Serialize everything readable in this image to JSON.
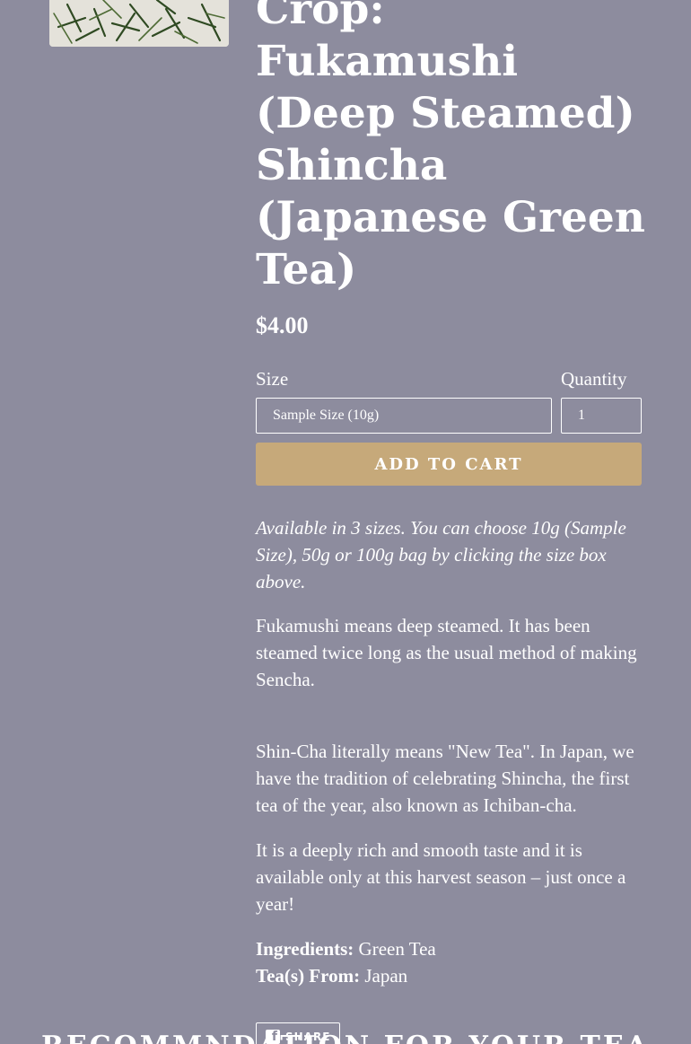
{
  "product": {
    "title": "Crop: Fukamushi (Deep Steamed) Shincha (Japanese Green Tea)",
    "price": "$4.00",
    "size_label": "Size",
    "quantity_label": "Quantity",
    "size_selected": "Sample Size (10g)",
    "quantity_value": "1",
    "add_to_cart": "ADD TO CART"
  },
  "description": {
    "availability": "Available in 3 sizes. You can choose 10g (Sample Size), 50g or 100g bag by clicking the size box above.",
    "fukamushi": "Fukamushi means deep steamed. It has been steamed twice long as the usual method of making Sencha.",
    "shincha": "Shin-Cha literally means \"New Tea\".  In Japan, we have the tradition of celebrating Shincha, the first tea of the year, also known as Ichiban-cha.",
    "taste": "It is a deeply rich and smooth taste and it is available only at this harvest season – just once a year!",
    "ingredients_label": "Ingredients:",
    "ingredients_value": " Green Tea",
    "origin_label": "Tea(s) From:",
    "origin_value": " Japan"
  },
  "share": {
    "label": "SHARE",
    "icon": "facebook-icon"
  },
  "recommendation_heading": "RECOMMNDATION FOR YOUR TEA"
}
